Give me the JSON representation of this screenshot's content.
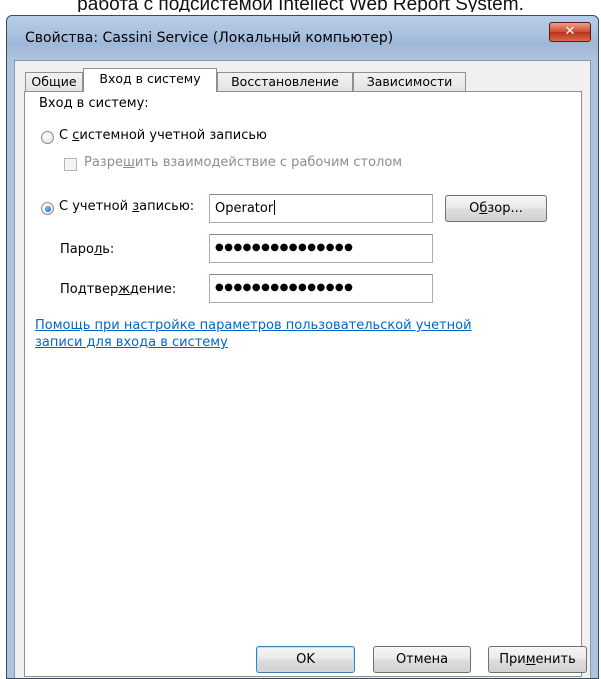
{
  "caption": "работа с подсистемой Intellect Web Report System.",
  "window": {
    "title": "Свойства: Cassini Service (Локальный компьютер)",
    "close_glyph": "✕"
  },
  "tabs": [
    {
      "label": "Общие"
    },
    {
      "label": "Вход в систему"
    },
    {
      "label": "Восстановление"
    },
    {
      "label": "Зависимости"
    }
  ],
  "logon": {
    "section_label": "Вход в систему:",
    "system_account": {
      "pre": "С ",
      "mnemonic": "с",
      "post": "истемной учетной записью",
      "checked": false
    },
    "desktop_interact": {
      "pre": "Разре",
      "mnemonic": "ш",
      "post": "ить взаимодействие с рабочим столом",
      "checked": false,
      "enabled": false
    },
    "this_account": {
      "pre": "С учетной ",
      "mnemonic": "з",
      "post": "аписью:",
      "checked": true
    },
    "account_value": "Operator",
    "browse_button": {
      "pre": "О",
      "mnemonic": "б",
      "post": "зор..."
    },
    "password_label": {
      "pre": "Паро",
      "mnemonic": "л",
      "post": "ь:"
    },
    "password_value": "●●●●●●●●●●●●●●●",
    "confirm_label": {
      "pre": "Подтвер",
      "mnemonic": "ж",
      "post": "дение:"
    },
    "confirm_value": "●●●●●●●●●●●●●●●",
    "help_link_line1": "Помощь при настройке параметров пользовательской учетной",
    "help_link_line2": "записи для входа в систему"
  },
  "footer": {
    "ok_label": "OK",
    "cancel_label": "Отмена",
    "apply": {
      "pre": "При",
      "mnemonic": "м",
      "post": "енить"
    }
  },
  "colors": {
    "accent_link": "#0066cc",
    "close_button": "#c7432a",
    "title_bar": "#aac3e0"
  }
}
